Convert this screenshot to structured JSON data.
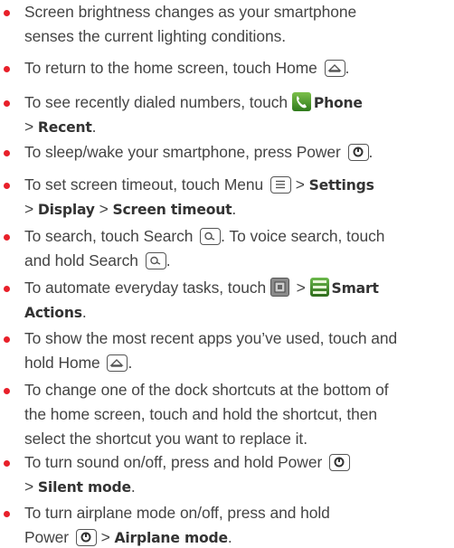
{
  "items": [
    {
      "lines": [
        [
          {
            "t": "Screen brightness changes as your smartphone"
          }
        ],
        [
          {
            "t": "senses the current lighting conditions."
          }
        ]
      ]
    },
    {
      "lines": [
        [
          {
            "t": "To return to the home screen, touch Home "
          },
          {
            "icon": "home-key-icon"
          },
          {
            "t": "."
          }
        ]
      ]
    },
    {
      "lines": [
        [
          {
            "t": "To see recently dialed numbers, touch "
          },
          {
            "icon": "phone-app-icon"
          },
          {
            "b": "Phone"
          }
        ],
        [
          {
            "t": "> "
          },
          {
            "b": "Recent"
          },
          {
            "t": "."
          }
        ]
      ]
    },
    {
      "lines": [
        [
          {
            "t": "To sleep/wake your smartphone, press Power "
          },
          {
            "icon": "power-key-icon"
          },
          {
            "t": "."
          }
        ]
      ]
    },
    {
      "lines": [
        [
          {
            "t": "To set screen timeout, touch Menu "
          },
          {
            "icon": "menu-key-icon"
          },
          {
            "t": " > "
          },
          {
            "b": "Settings"
          }
        ],
        [
          {
            "t": "> "
          },
          {
            "b": "Display"
          },
          {
            "t": " > "
          },
          {
            "b": "Screen timeout"
          },
          {
            "t": "."
          }
        ]
      ]
    },
    {
      "lines": [
        [
          {
            "t": "To search, touch Search "
          },
          {
            "icon": "search-key-icon"
          },
          {
            "t": ". To voice search, touch"
          }
        ],
        [
          {
            "t": "and hold Search "
          },
          {
            "icon": "search-key-icon"
          },
          {
            "t": "."
          }
        ]
      ]
    },
    {
      "lines": [
        [
          {
            "t": "To automate everyday tasks, touch "
          },
          {
            "icon": "app-grid-icon"
          },
          {
            "t": " > "
          },
          {
            "icon": "smart-actions-icon"
          },
          {
            "b": "Smart"
          }
        ],
        [
          {
            "b": "Actions"
          },
          {
            "t": "."
          }
        ]
      ]
    },
    {
      "lines": [
        [
          {
            "t": "To show the most recent apps you’ve used, touch and"
          }
        ],
        [
          {
            "t": "hold Home "
          },
          {
            "icon": "home-key-icon"
          },
          {
            "t": "."
          }
        ]
      ]
    },
    {
      "lines": [
        [
          {
            "t": "To change one of the dock shortcuts at the bottom of"
          }
        ],
        [
          {
            "t": "the home screen, touch and hold the shortcut, then"
          }
        ],
        [
          {
            "t": "select the shortcut you want to replace it."
          }
        ]
      ]
    },
    {
      "lines": [
        [
          {
            "t": "To turn sound on/off, press and hold Power "
          },
          {
            "icon": "power-key-icon"
          }
        ],
        [
          {
            "t": "> "
          },
          {
            "b": "Silent mode"
          },
          {
            "t": "."
          }
        ]
      ]
    },
    {
      "lines": [
        [
          {
            "t": "To turn airplane mode on/off, press and hold"
          }
        ],
        [
          {
            "t": "Power "
          },
          {
            "icon": "power-key-icon"
          },
          {
            "t": " > "
          },
          {
            "b": "Airplane mode"
          },
          {
            "t": "."
          }
        ]
      ]
    }
  ],
  "colors": {
    "bullet": "#e8202a",
    "text": "#444444",
    "bold": "#333333"
  }
}
